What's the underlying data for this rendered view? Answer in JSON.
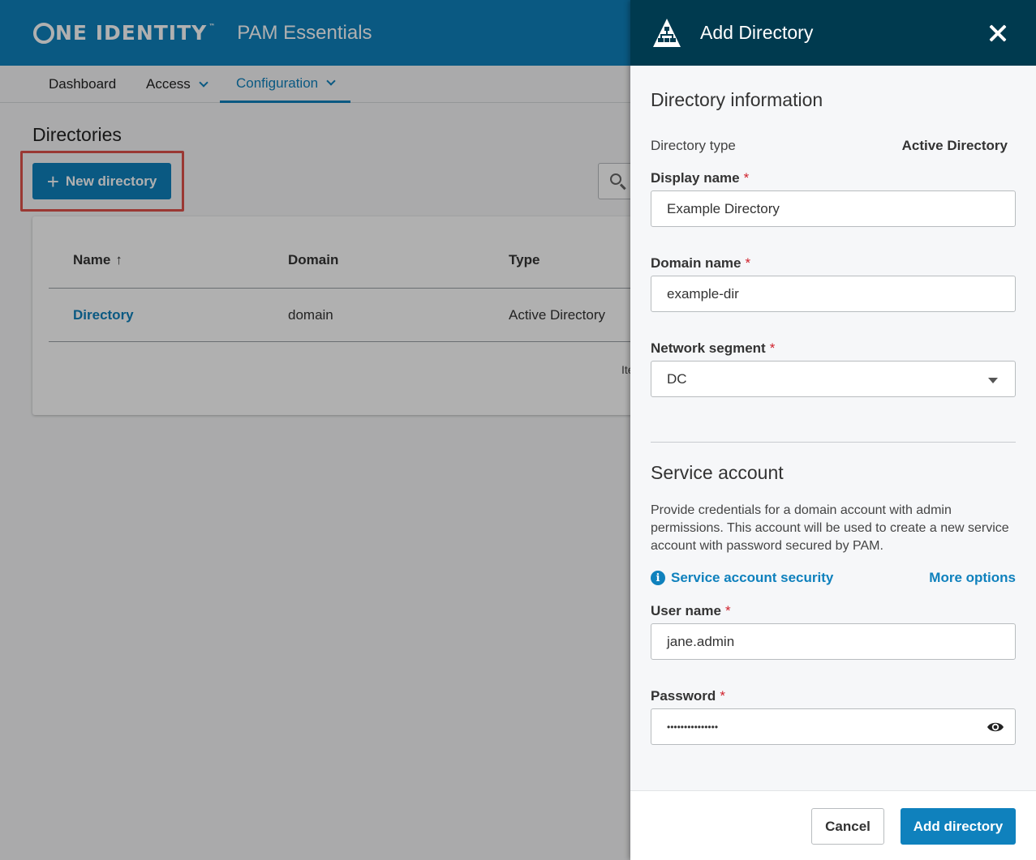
{
  "app": {
    "brand": "NE IDENTITY",
    "brand_tm": "™",
    "product": "PAM Essentials"
  },
  "nav": {
    "items": [
      {
        "label": "Dashboard",
        "has_menu": false
      },
      {
        "label": "Access",
        "has_menu": true
      },
      {
        "label": "Configuration",
        "has_menu": true,
        "active": true
      }
    ]
  },
  "page": {
    "title": "Directories",
    "new_button_label": "New directory",
    "table": {
      "headers": [
        "Name",
        "Domain",
        "Type"
      ],
      "sort_indicator": "↑",
      "rows": [
        {
          "name": "Directory",
          "domain": "domain",
          "type": "Active Directory"
        }
      ],
      "footer_fragment": "Ite"
    }
  },
  "drawer": {
    "title": "Add Directory",
    "directory_info": {
      "title": "Directory information",
      "type_label": "Directory type",
      "type_value": "Active Directory",
      "display_name": {
        "label": "Display name",
        "required": "*",
        "value": "Example Directory"
      },
      "domain_name": {
        "label": "Domain name",
        "required": "*",
        "value": "example-dir"
      },
      "network_segment": {
        "label": "Network segment",
        "required": "*",
        "value": "DC"
      }
    },
    "service_account": {
      "title": "Service account",
      "description": "Provide credentials for a domain account with admin permissions. This account will be used to create a new service account with password secured by PAM.",
      "security_link": "Service account security",
      "more_options": "More options",
      "user_name": {
        "label": "User name",
        "required": "*",
        "value": "jane.admin"
      },
      "password": {
        "label": "Password",
        "required": "*",
        "value": "•••••••••••••••"
      }
    },
    "footer": {
      "cancel": "Cancel",
      "add": "Add directory"
    }
  },
  "colors": {
    "brand_blue": "#0f81bd",
    "drawer_header": "#003a4f",
    "highlight": "#e0524b",
    "required": "#d0212c"
  }
}
